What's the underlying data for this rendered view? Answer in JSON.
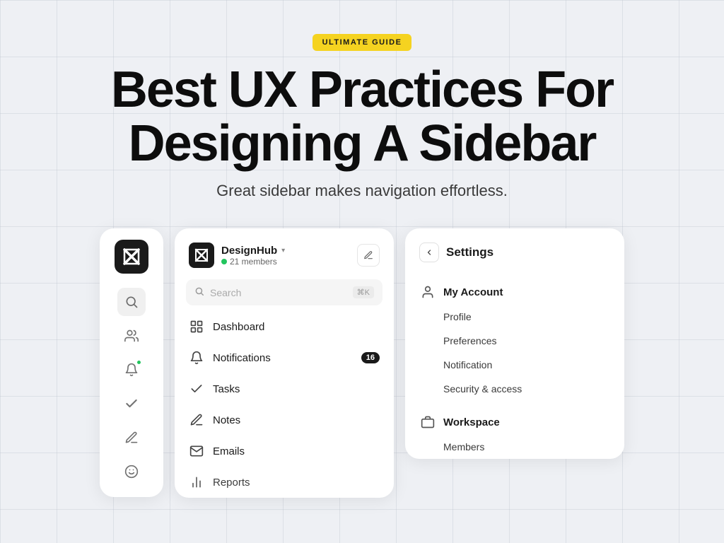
{
  "badge": {
    "label": "ULTIMATE GUIDE"
  },
  "hero": {
    "title_line1": "Best UX Practices For",
    "title_line2": "Designing A Sidebar",
    "subtitle": "Great sidebar makes navigation effortless."
  },
  "card1": {
    "aria": "icon-only sidebar"
  },
  "card2": {
    "app_name": "DesignHub",
    "chevron": "▾",
    "members": "21 members",
    "search_placeholder": "Search",
    "search_shortcut": "⌘K",
    "nav_items": [
      {
        "label": "Dashboard",
        "icon": "dashboard"
      },
      {
        "label": "Notifications",
        "icon": "notifications",
        "badge": "16"
      },
      {
        "label": "Tasks",
        "icon": "tasks"
      },
      {
        "label": "Notes",
        "icon": "notes"
      },
      {
        "label": "Emails",
        "icon": "emails"
      },
      {
        "label": "Reports",
        "icon": "reports"
      }
    ]
  },
  "card3": {
    "back_label": "<",
    "title": "Settings",
    "sections": [
      {
        "label": "My Account",
        "icon": "account",
        "sub_items": [
          "Profile",
          "Preferences",
          "Notification",
          "Security & access"
        ]
      },
      {
        "label": "Workspace",
        "icon": "workspace",
        "sub_items": [
          "Members"
        ]
      }
    ]
  }
}
